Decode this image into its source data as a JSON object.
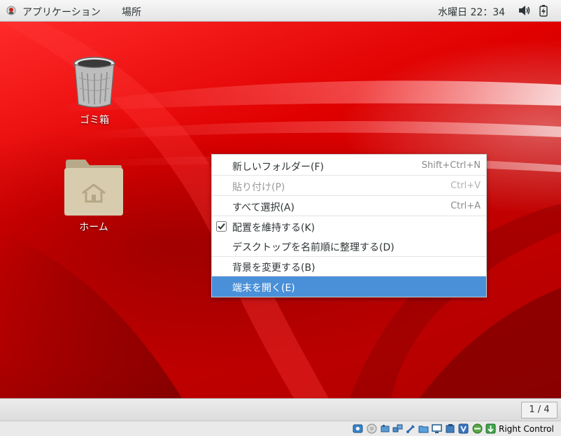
{
  "top_panel": {
    "applications": "アプリケーション",
    "places": "場所",
    "clock": "水曜日 22：34"
  },
  "desktop": {
    "icons": [
      {
        "label": "ゴミ箱",
        "icon": "trash-icon"
      },
      {
        "label": "ホーム",
        "icon": "home-folder-icon"
      }
    ]
  },
  "context_menu": {
    "items": [
      {
        "label": "新しいフォルダー(F)",
        "accel": "Shift+Ctrl+N",
        "enabled": true
      },
      {
        "label": "貼り付け(P)",
        "accel": "Ctrl+V",
        "enabled": false
      },
      {
        "label": "すべて選択(A)",
        "accel": "Ctrl+A",
        "enabled": true
      },
      {
        "label": "配置を維持する(K)",
        "accel": "",
        "enabled": true,
        "checked": true
      },
      {
        "label": "デスクトップを名前順に整理する(D)",
        "accel": "",
        "enabled": true
      },
      {
        "label": "背景を変更する(B)",
        "accel": "",
        "enabled": true
      },
      {
        "label": "端末を開く(E)",
        "accel": "",
        "enabled": true,
        "highlighted": true
      }
    ]
  },
  "bottom_panel": {
    "workspace": "1 / 4"
  },
  "vbox_status": {
    "host_key": "Right Control"
  },
  "colors": {
    "highlight": "#4a90d9",
    "desktop_red": "#e00000"
  }
}
